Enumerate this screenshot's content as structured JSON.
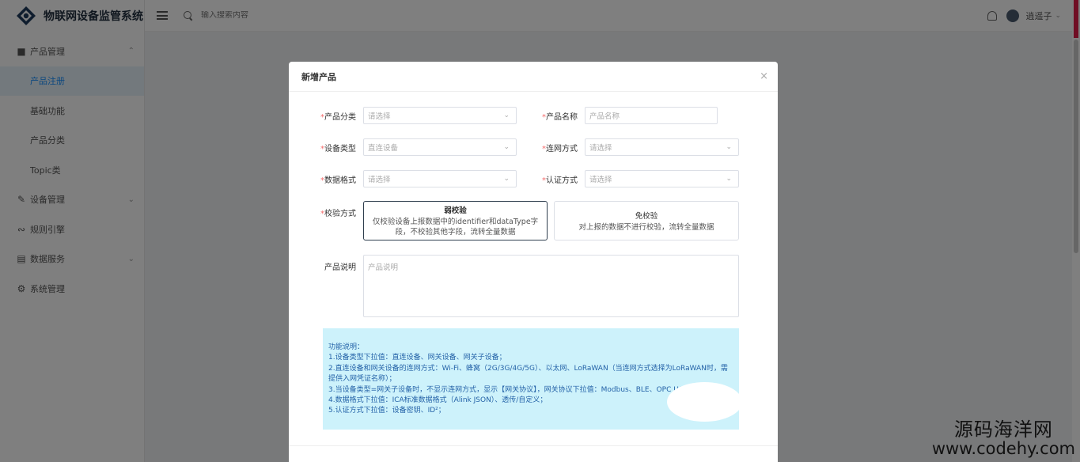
{
  "app": {
    "title": "物联网设备监管系统",
    "search_placeholder": "输入搜索内容",
    "user_name": "逍遥子"
  },
  "sidebar": {
    "groups": [
      {
        "label": "产品管理",
        "icon": "puzzle-icon",
        "expanded": true,
        "children": [
          {
            "label": "产品注册",
            "active": true
          },
          {
            "label": "基础功能",
            "active": false
          },
          {
            "label": "产品分类",
            "active": false
          },
          {
            "label": "Topic类",
            "active": false
          }
        ]
      },
      {
        "label": "设备管理",
        "icon": "wrench-icon",
        "expanded": false
      },
      {
        "label": "规则引擎",
        "icon": "rss-icon",
        "expanded": false
      },
      {
        "label": "数据服务",
        "icon": "monitor-icon",
        "expanded": false
      },
      {
        "label": "系统管理",
        "icon": "gear-icon",
        "expanded": false
      }
    ]
  },
  "modal": {
    "title": "新增产品",
    "close": "×",
    "fields": {
      "category": {
        "label": "产品分类",
        "placeholder": "请选择"
      },
      "name": {
        "label": "产品名称",
        "placeholder": "产品名称"
      },
      "device_type": {
        "label": "设备类型",
        "value": "直连设备"
      },
      "network": {
        "label": "连网方式",
        "placeholder": "请选择"
      },
      "data_format": {
        "label": "数据格式",
        "placeholder": "请选择"
      },
      "auth": {
        "label": "认证方式",
        "placeholder": "请选择"
      },
      "verify": {
        "label": "校验方式",
        "options": [
          {
            "title": "弱校验",
            "desc": "仅校验设备上报数据中的identifier和dataType字段，不校验其他字段，流转全量数据",
            "selected": true
          },
          {
            "title": "免校验",
            "desc": "对上报的数据不进行校验，流转全量数据",
            "selected": false
          }
        ]
      },
      "description": {
        "label": "产品说明",
        "placeholder": "产品说明"
      }
    },
    "info": {
      "lines": [
        "功能说明：",
        "1.设备类型下拉值：直连设备、网关设备、网关子设备；",
        "2.直连设备和网关设备的连网方式：Wi-Fi、蜂窝（2G/3G/4G/5G）、以太网、LoRaWAN（当连网方式选择为LoRaWAN时，需提供入网凭证名称）；",
        "3.当设备类型=网关子设备时，不显示连网方式，显示【网关协议】，网关协议下拉值：Modbus、BLE、OPC UA、ZigBee",
        "4.数据格式下拉值：ICA标准数据格式（Alink JSON）、透传/自定义；",
        "5.认证方式下拉值：设备密钥、ID²；"
      ]
    }
  },
  "watermark": {
    "line1": "源码海洋网",
    "line2": "www.codehy.com"
  }
}
